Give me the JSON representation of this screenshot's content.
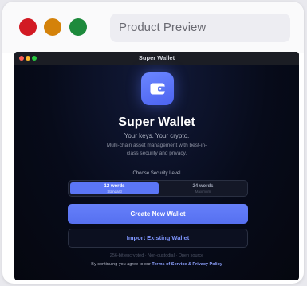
{
  "frame": {
    "preview_label": "Product Preview"
  },
  "window": {
    "title": "Super Wallet"
  },
  "hero": {
    "logo_icon": "wallet-icon",
    "title": "Super Wallet",
    "tagline": "Your keys. Your crypto.",
    "description": "Multi-chain asset management with best-in-class security and privacy."
  },
  "security": {
    "label": "Choose Security Level",
    "options": [
      {
        "label": "12 words",
        "sublabel": "Standard",
        "selected": true
      },
      {
        "label": "24 words",
        "sublabel": "Maximum",
        "selected": false
      }
    ]
  },
  "actions": {
    "create_label": "Create New Wallet",
    "import_label": "Import Existing Wallet"
  },
  "footer": {
    "features": "256-bit encrypted · Non-custodial · Open source",
    "terms_prefix": "By continuing you agree to our",
    "terms_link": "Terms of Service",
    "terms_joiner": "&",
    "privacy_link": "Privacy Policy"
  },
  "colors": {
    "accent": "#5b76f5",
    "background": "#070b1a"
  }
}
